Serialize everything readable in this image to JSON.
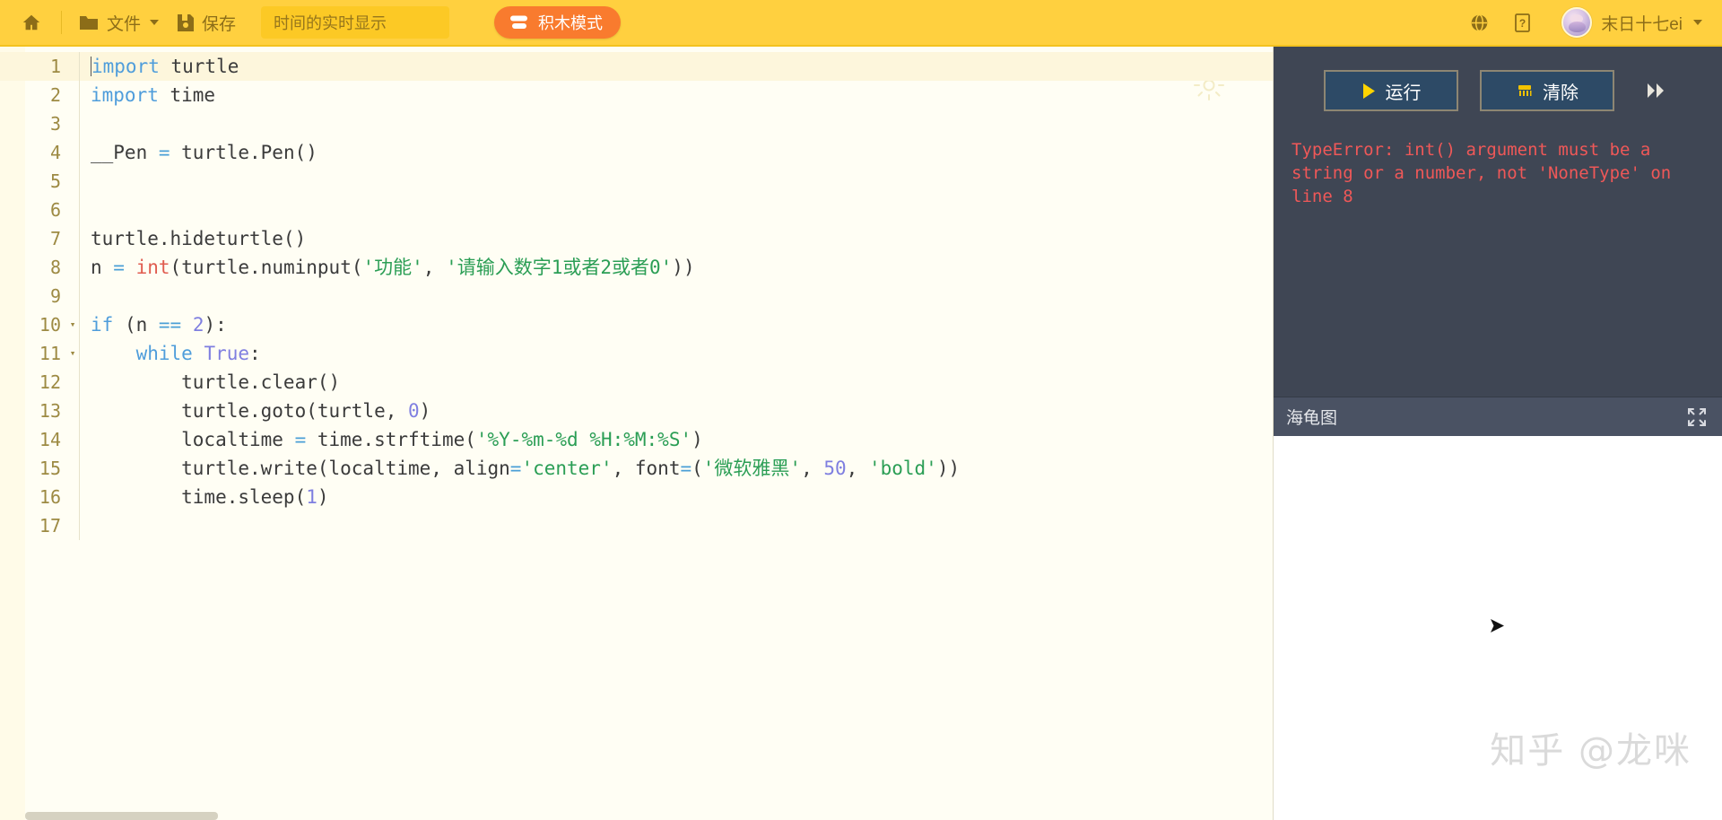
{
  "toolbar": {
    "home_label": "",
    "file_label": "文件",
    "save_label": "保存",
    "project_title": "时间的实时显示",
    "project_title_placeholder": "时间的实时显示",
    "mode_label": "积木模式",
    "user_name": "末日十七ei",
    "accent_bg": "#ffd03f",
    "mode_bg": "#f97b2e",
    "text_color": "#8c6d18"
  },
  "editor": {
    "active_line": 1,
    "lines": [
      {
        "n": "1",
        "fold": "",
        "tokens": [
          {
            "t": "import",
            "c": "kw"
          },
          {
            "t": " turtle",
            "c": ""
          }
        ]
      },
      {
        "n": "2",
        "fold": "",
        "tokens": [
          {
            "t": "import",
            "c": "kw"
          },
          {
            "t": " time",
            "c": ""
          }
        ]
      },
      {
        "n": "3",
        "fold": "",
        "tokens": []
      },
      {
        "n": "4",
        "fold": "",
        "tokens": [
          {
            "t": "__Pen ",
            "c": ""
          },
          {
            "t": "=",
            "c": "op"
          },
          {
            "t": " turtle.Pen()",
            "c": ""
          }
        ]
      },
      {
        "n": "5",
        "fold": "",
        "tokens": []
      },
      {
        "n": "6",
        "fold": "",
        "tokens": []
      },
      {
        "n": "7",
        "fold": "",
        "tokens": [
          {
            "t": "turtle.hideturtle()",
            "c": ""
          }
        ]
      },
      {
        "n": "8",
        "fold": "",
        "tokens": [
          {
            "t": "n ",
            "c": ""
          },
          {
            "t": "=",
            "c": "op"
          },
          {
            "t": " ",
            "c": ""
          },
          {
            "t": "int",
            "c": "bi"
          },
          {
            "t": "(turtle.numinput(",
            "c": ""
          },
          {
            "t": "'功能'",
            "c": "str"
          },
          {
            "t": ", ",
            "c": ""
          },
          {
            "t": "'请输入数字1或者2或者0'",
            "c": "str"
          },
          {
            "t": "))",
            "c": ""
          }
        ]
      },
      {
        "n": "9",
        "fold": "",
        "tokens": []
      },
      {
        "n": "10",
        "fold": "▾",
        "tokens": [
          {
            "t": "if",
            "c": "kw"
          },
          {
            "t": " (n ",
            "c": ""
          },
          {
            "t": "==",
            "c": "op"
          },
          {
            "t": " ",
            "c": ""
          },
          {
            "t": "2",
            "c": "num"
          },
          {
            "t": "):",
            "c": ""
          }
        ]
      },
      {
        "n": "11",
        "fold": "▾",
        "tokens": [
          {
            "t": "    ",
            "c": ""
          },
          {
            "t": "while",
            "c": "kw"
          },
          {
            "t": " ",
            "c": ""
          },
          {
            "t": "True",
            "c": "kw2"
          },
          {
            "t": ":",
            "c": ""
          }
        ]
      },
      {
        "n": "12",
        "fold": "",
        "tokens": [
          {
            "t": "        turtle.clear()",
            "c": ""
          }
        ]
      },
      {
        "n": "13",
        "fold": "",
        "tokens": [
          {
            "t": "        turtle.goto(turtle, ",
            "c": ""
          },
          {
            "t": "0",
            "c": "num"
          },
          {
            "t": ")",
            "c": ""
          }
        ]
      },
      {
        "n": "14",
        "fold": "",
        "tokens": [
          {
            "t": "        localtime ",
            "c": ""
          },
          {
            "t": "=",
            "c": "op"
          },
          {
            "t": " time.strftime(",
            "c": ""
          },
          {
            "t": "'%Y-%m-%d %H:%M:%S'",
            "c": "str"
          },
          {
            "t": ")",
            "c": ""
          }
        ]
      },
      {
        "n": "15",
        "fold": "",
        "tokens": [
          {
            "t": "        turtle.write(localtime, align",
            "c": ""
          },
          {
            "t": "=",
            "c": "op"
          },
          {
            "t": "'center'",
            "c": "str"
          },
          {
            "t": ", font",
            "c": ""
          },
          {
            "t": "=",
            "c": "op"
          },
          {
            "t": "(",
            "c": ""
          },
          {
            "t": "'微软雅黑'",
            "c": "str"
          },
          {
            "t": ", ",
            "c": ""
          },
          {
            "t": "50",
            "c": "num"
          },
          {
            "t": ", ",
            "c": ""
          },
          {
            "t": "'bold'",
            "c": "str"
          },
          {
            "t": "))",
            "c": ""
          }
        ]
      },
      {
        "n": "16",
        "fold": "",
        "tokens": [
          {
            "t": "        time.sleep(",
            "c": ""
          },
          {
            "t": "1",
            "c": "num"
          },
          {
            "t": ")",
            "c": ""
          }
        ]
      },
      {
        "n": "17",
        "fold": "",
        "tokens": []
      }
    ]
  },
  "console": {
    "run_label": "运行",
    "clear_label": "清除",
    "error_text": "TypeError: int() argument must be a string or a number, not 'NoneType' on line 8",
    "error_color": "#ef5858",
    "bg": "#3f4654"
  },
  "turtle_panel": {
    "title": "海龟图",
    "canvas_bg": "#ffffff",
    "watermark": "知乎 @龙咪"
  }
}
